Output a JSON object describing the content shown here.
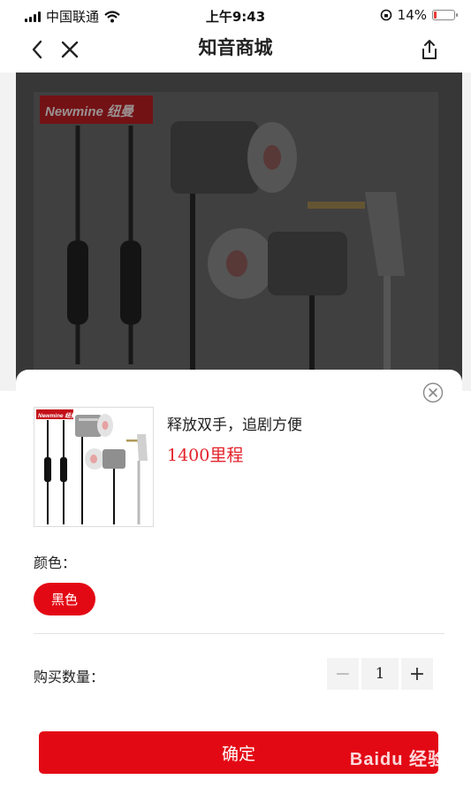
{
  "status_bar": {
    "carrier": "中国联通",
    "time": "上午9:43",
    "battery": "14%",
    "battery_level": 0.14
  },
  "nav": {
    "title": "知音商城"
  },
  "product_image": {
    "brand_logo": "Newmine 纽曼"
  },
  "sheet": {
    "product_name": "释放双手，追剧方便",
    "price": "1400里程",
    "color_label": "颜色：",
    "color_option": "黑色",
    "quantity_label": "购买数量：",
    "quantity": "1",
    "minus": "−",
    "plus": "+",
    "confirm": "确定"
  },
  "watermark": "Baidu 经验",
  "colors": {
    "accent": "#e30914",
    "price": "#e3222b"
  }
}
